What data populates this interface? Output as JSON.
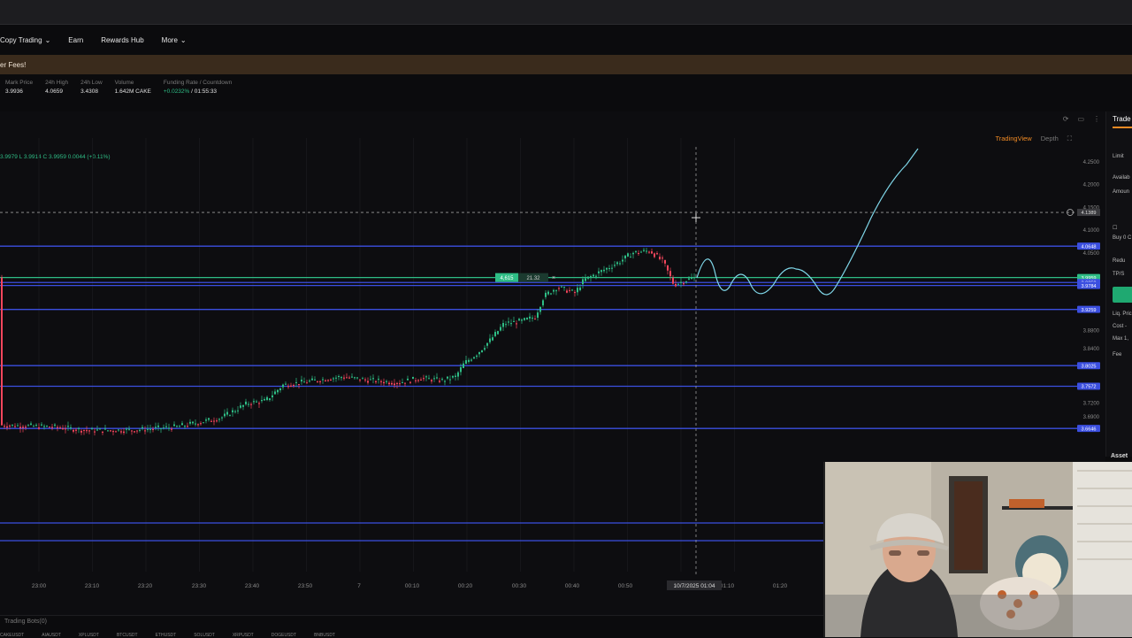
{
  "nav": {
    "items": [
      {
        "label": "Copy Trading",
        "chevron": true
      },
      {
        "label": "Earn",
        "chevron": false
      },
      {
        "label": "Rewards Hub",
        "chevron": false
      },
      {
        "label": "More",
        "chevron": true
      }
    ]
  },
  "banner": {
    "text": "er Fees!"
  },
  "ticker": {
    "mark_price": {
      "label": "Mark Price",
      "value": "3.9936"
    },
    "high_24h": {
      "label": "24h High",
      "value": "4.0659"
    },
    "low_24h": {
      "label": "24h Low",
      "value": "3.4308"
    },
    "volume": {
      "label": "Volume",
      "value": "1.642M CAKE"
    },
    "funding": {
      "label": "Funding Rate / Countdown",
      "rate": "+0.0232%",
      "countdown": " / 01:55:33"
    }
  },
  "chart_header": {
    "tab_tradingview": "TradingView",
    "tab_depth": "Depth",
    "ohlc": "3.9979  L 3.9914  C 3.9959  0.0044 (+0.11%)"
  },
  "chart_data": {
    "type": "candlestick",
    "y_ticks": [
      "4.2500",
      "4.2000",
      "4.1500",
      "4.1000",
      "4.0500",
      "3.8800",
      "3.8400",
      "3.7200",
      "3.6900"
    ],
    "x_ticks": [
      "23:00",
      "23:10",
      "23:20",
      "23:30",
      "23:40",
      "23:50",
      "7",
      "00:10",
      "00:20",
      "00:30",
      "00:40",
      "00:50",
      "01:10",
      "01:20"
    ],
    "crosshair_time": "10/7/2025  01:04",
    "crosshair_price": "4.1389",
    "horizontal_levels": [
      {
        "price": "4.0648",
        "color": "#3b4fe0"
      },
      {
        "price": "3.9959",
        "color": "#2ebd85"
      },
      {
        "price": "3.9850",
        "color": "#3b4fe0"
      },
      {
        "price": "3.9784",
        "color": "#3b4fe0"
      },
      {
        "price": "3.9259",
        "color": "#3b4fe0"
      },
      {
        "price": "3.8025",
        "color": "#3b4fe0"
      },
      {
        "price": "3.7572",
        "color": "#3b4fe0"
      },
      {
        "price": "3.6646",
        "color": "#3b4fe0"
      }
    ],
    "order_tag": {
      "qty": "4,615",
      "value": "21.32",
      "close": "×"
    },
    "projection_color": "#7fd6e8",
    "up_color": "#2ebd85",
    "down_color": "#f6465d"
  },
  "right_panel": {
    "trade_tab": "Trade",
    "limit": "Limit",
    "available": "Availab",
    "amount": "Amoun",
    "buy": "Buy 0 C",
    "reduce": "Redu",
    "tpsl": "TP/S",
    "liq": "Liq. Pric",
    "cost": "Cost -",
    "max": "Max 1,",
    "fees": "Fee",
    "assets": "Asset"
  },
  "bottom": {
    "trading_bots": "Trading Bots(0)",
    "strip": [
      "CAKEUSDT",
      "AIAUSDT",
      "XPLUSDT",
      "BTCUSDT",
      "ETHUSDT",
      "SOLUSDT",
      "XRPUSDT",
      "DOGEUSDT",
      "BNBUSDT"
    ]
  }
}
